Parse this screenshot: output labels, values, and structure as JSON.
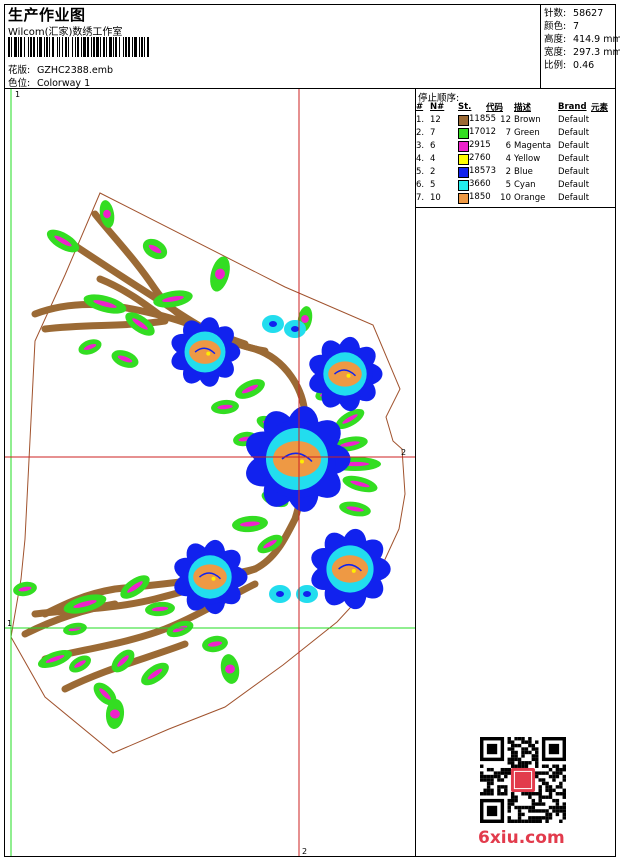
{
  "header": {
    "title": "生产作业图",
    "studio": "Wilcom(汇家)数绣工作室",
    "pattern_label": "花版:",
    "pattern_value": "GZHC2388.emb",
    "colorway_label": "色位:",
    "colorway_value": "Colorway 1"
  },
  "stats": {
    "stitches_label": "针数:",
    "stitches_value": "58627",
    "colors_label": "颜色:",
    "colors_value": "7",
    "height_label": "高度:",
    "height_value": "414.9 mm",
    "width_label": "宽度:",
    "width_value": "297.3 mm",
    "scale_label": "比例:",
    "scale_value": "0.46"
  },
  "stop_sequence": {
    "title": "停止顺序:",
    "headers": [
      "#",
      "N#",
      "St.",
      "代码",
      "描述",
      "Brand",
      "元素"
    ],
    "rows": [
      {
        "idx": "1.",
        "n": "12",
        "color": "#9b6a35",
        "st": "11855",
        "code": "12",
        "desc": "Brown",
        "brand": "Default"
      },
      {
        "idx": "2.",
        "n": "7",
        "color": "#33dd22",
        "st": "17012",
        "code": "7",
        "desc": "Green",
        "brand": "Default"
      },
      {
        "idx": "3.",
        "n": "6",
        "color": "#ee22cc",
        "st": "2915",
        "code": "6",
        "desc": "Magenta",
        "brand": "Default"
      },
      {
        "idx": "4.",
        "n": "4",
        "color": "#ffff00",
        "st": "2760",
        "code": "4",
        "desc": "Yellow",
        "brand": "Default"
      },
      {
        "idx": "5.",
        "n": "2",
        "color": "#1122ee",
        "st": "18573",
        "code": "2",
        "desc": "Blue",
        "brand": "Default"
      },
      {
        "idx": "6.",
        "n": "5",
        "color": "#22eeee",
        "st": "3660",
        "code": "5",
        "desc": "Cyan",
        "brand": "Default"
      },
      {
        "idx": "7.",
        "n": "10",
        "color": "#ee9944",
        "st": "1850",
        "code": "10",
        "desc": "Orange",
        "brand": "Default"
      }
    ]
  },
  "guides": {
    "label_1": "1",
    "label_2": "2"
  },
  "watermark": "6xiu.com"
}
